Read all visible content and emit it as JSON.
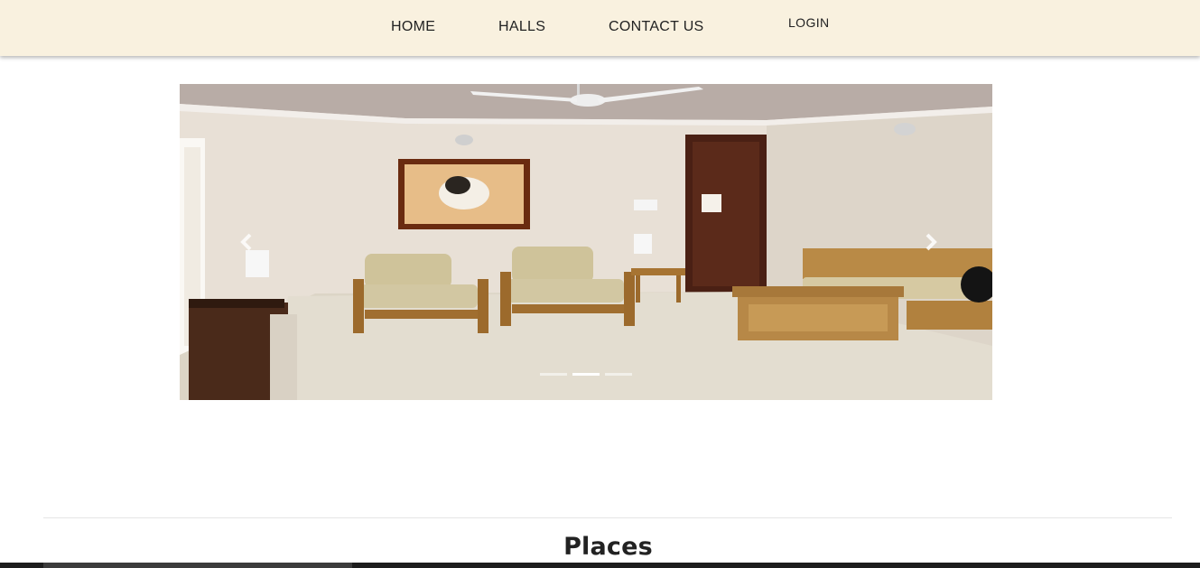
{
  "nav": {
    "items": [
      {
        "label": "HOME"
      },
      {
        "label": "HALLS"
      },
      {
        "label": "CONTACT US"
      }
    ],
    "login_label": "LOGIN"
  },
  "carousel": {
    "slide_count": 3,
    "active_index": 1,
    "prev_icon": "chevron-left-icon",
    "next_icon": "chevron-right-icon"
  },
  "section": {
    "title": "Places"
  },
  "colors": {
    "nav_background": "#f9f1df",
    "page_background": "#ffffff",
    "text": "#222222"
  }
}
